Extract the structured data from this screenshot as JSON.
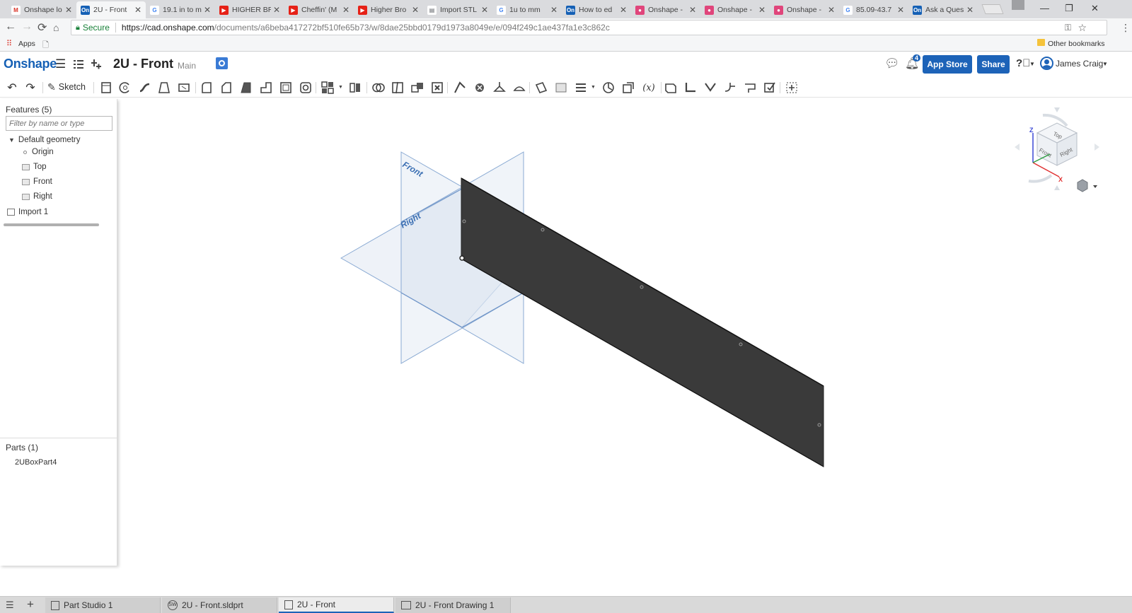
{
  "browser": {
    "tabs": [
      {
        "label": "Onshape lo",
        "icon": "gmail-icon",
        "color": "#d93025",
        "glyph": "M"
      },
      {
        "label": "2U - Front",
        "icon": "onshape-icon",
        "color": "#1560b5",
        "glyph": "On",
        "active": true
      },
      {
        "label": "19.1 in to m",
        "icon": "google-icon",
        "color": "#4285f4",
        "glyph": "G"
      },
      {
        "label": "HIGHER BR",
        "icon": "youtube-icon",
        "color": "#e62117",
        "glyph": "▶"
      },
      {
        "label": "Cheffin' (M",
        "icon": "youtube-icon",
        "color": "#e62117",
        "glyph": "▶"
      },
      {
        "label": "Higher Bro",
        "icon": "youtube-icon",
        "color": "#e62117",
        "glyph": "▶"
      },
      {
        "label": "Import STL",
        "icon": "page-icon",
        "color": "#5f6368",
        "glyph": "▤"
      },
      {
        "label": "1u to mm",
        "icon": "google-icon",
        "color": "#4285f4",
        "glyph": "G"
      },
      {
        "label": "How to ed",
        "icon": "onshape-icon",
        "color": "#1560b5",
        "glyph": "On"
      },
      {
        "label": "Onshape -",
        "icon": "forum-icon",
        "color": "#e0457b",
        "glyph": "●"
      },
      {
        "label": "Onshape -",
        "icon": "forum-icon",
        "color": "#e0457b",
        "glyph": "●"
      },
      {
        "label": "Onshape -",
        "icon": "forum-icon",
        "color": "#e0457b",
        "glyph": "●"
      },
      {
        "label": "85.09-43.7",
        "icon": "google-icon",
        "color": "#4285f4",
        "glyph": "G"
      },
      {
        "label": "Ask a Ques",
        "icon": "onshape-icon",
        "color": "#1560b5",
        "glyph": "On"
      }
    ],
    "secure_label": "Secure",
    "url_host": "https://cad.onshape.com",
    "url_path": "/documents/a6beba417272bf510fe65b73/w/8dae25bbd0179d1973a8049e/e/094f249c1ae437fa1e3c862c",
    "bookmarks": {
      "apps_label": "Apps",
      "other_label": "Other bookmarks"
    }
  },
  "header": {
    "logo": "Onshape",
    "doc_title": "2U - Front",
    "branch": "Main",
    "notification_count": "4",
    "app_store_label": "App Store",
    "share_label": "Share",
    "user_name": "James Craig"
  },
  "toolbar": {
    "sketch_label": "Sketch",
    "variable_label": "(x)"
  },
  "feature_panel": {
    "title": "Features (5)",
    "filter_placeholder": "Filter by name or type",
    "default_geometry": "Default geometry",
    "origin": "Origin",
    "planes": [
      "Top",
      "Front",
      "Right"
    ],
    "import": "Import 1",
    "parts_title": "Parts (1)",
    "part_name": "2UBoxPart4"
  },
  "viewport": {
    "plane_labels": {
      "front": "Front",
      "right": "Right"
    },
    "cube_faces": {
      "top": "Top",
      "front": "Front",
      "right": "Right"
    },
    "axis_labels": {
      "z": "Z",
      "x": "X"
    },
    "colors": {
      "plane_fill": "#dde6f2",
      "plane_edge": "#8aaad3",
      "part_fill": "#3a3a3a",
      "plane_text": "#3b6fb3"
    }
  },
  "bottom_tabs": [
    {
      "label": "Part Studio 1",
      "icon": "part-studio-icon"
    },
    {
      "label": "2U - Front.sldprt",
      "icon": "solidworks-file-icon"
    },
    {
      "label": "2U - Front",
      "icon": "part-studio-icon",
      "active": true
    },
    {
      "label": "2U - Front Drawing 1",
      "icon": "drawing-icon"
    }
  ]
}
